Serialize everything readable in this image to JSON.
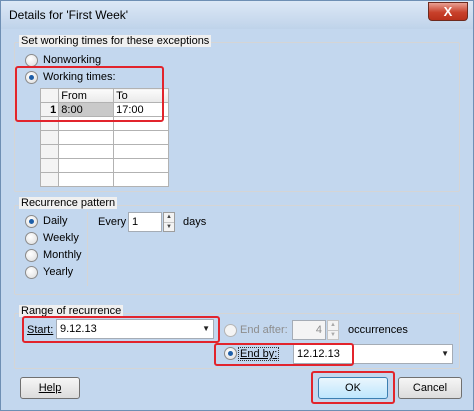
{
  "window": {
    "title": "Details for 'First Week'",
    "close_glyph": "X"
  },
  "exceptions": {
    "group_label": "Set working times for these exceptions",
    "nonworking_label": "Nonworking",
    "working_times_label": "Working times:",
    "selected": "working_times",
    "grid": {
      "columns": [
        "From",
        "To"
      ],
      "rows": [
        {
          "num": "1",
          "from": "8:00",
          "to": "17:00"
        },
        {
          "num": "",
          "from": "",
          "to": ""
        },
        {
          "num": "",
          "from": "",
          "to": ""
        },
        {
          "num": "",
          "from": "",
          "to": ""
        },
        {
          "num": "",
          "from": "",
          "to": ""
        },
        {
          "num": "",
          "from": "",
          "to": ""
        }
      ]
    }
  },
  "recurrence": {
    "group_label": "Recurrence pattern",
    "options": [
      "Daily",
      "Weekly",
      "Monthly",
      "Yearly"
    ],
    "selected": "Daily",
    "every_label": "Every",
    "every_value": "1",
    "days_label": "days"
  },
  "range": {
    "group_label": "Range of recurrence",
    "start_label": "Start:",
    "start_value": "9.12.13",
    "end_after_label": "End after:",
    "end_after_value": "4",
    "occurrences_label": "occurrences",
    "end_by_label": "End by:",
    "end_by_value": "12.12.13",
    "selected": "end_by"
  },
  "buttons": {
    "help": "Help",
    "ok": "OK",
    "cancel": "Cancel"
  },
  "colors": {
    "highlight": "#e2242c",
    "title_bar": "#c3d7ee",
    "close_button": "#c8412b"
  }
}
